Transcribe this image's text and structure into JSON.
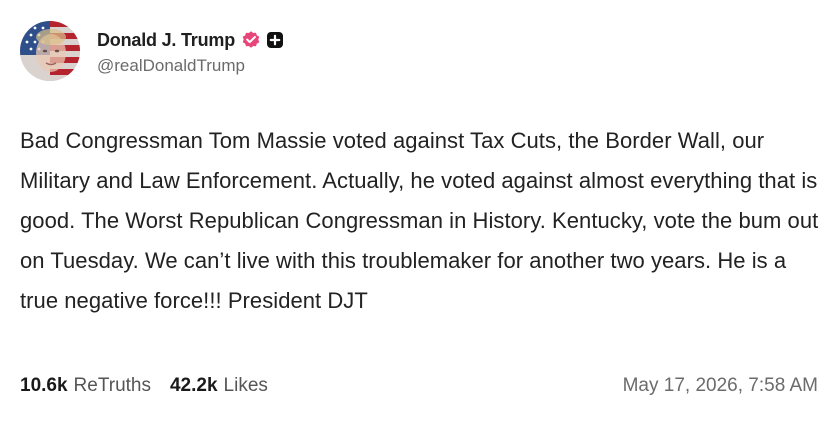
{
  "author": {
    "display_name": "Donald J. Trump",
    "handle": "@realDonaldTrump",
    "avatar_icon": "flag-portrait-avatar",
    "badges": [
      "verified-badge-icon",
      "plus-badge-icon"
    ]
  },
  "post": {
    "text": "Bad Congressman Tom Massie voted against Tax Cuts, the Border Wall, our Military and Law Enforcement. Actually, he voted against almost everything that is good. The Worst Republican Congressman in History. Kentucky, vote the bum out on Tuesday. We can’t live with this troublemaker for another two years. He is a true negative force!!! President DJT"
  },
  "stats": {
    "retruths_count": "10.6k",
    "retruths_label": "ReTruths",
    "likes_count": "42.2k",
    "likes_label": "Likes"
  },
  "timestamp": "May 17, 2026, 7:58 AM",
  "colors": {
    "verified_badge": "#e8457a",
    "text": "#222222",
    "muted": "#6b6b6b"
  }
}
